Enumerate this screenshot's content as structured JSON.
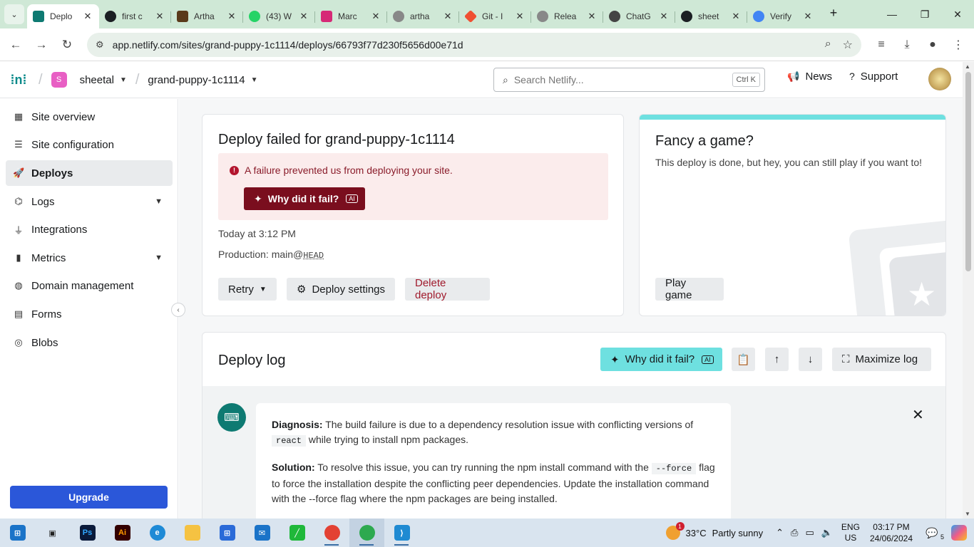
{
  "browser": {
    "tabs": [
      {
        "title": "Deplo",
        "favicon_color": "#0e7a72",
        "active": true
      },
      {
        "title": "first c",
        "favicon_color": "#1b1f23"
      },
      {
        "title": "Artha",
        "favicon_color": "#5a3a1a"
      },
      {
        "title": "(43) W",
        "favicon_color": "#25d366"
      },
      {
        "title": "Marc",
        "favicon_color": "#d62976"
      },
      {
        "title": "artha",
        "favicon_color": "#666666"
      },
      {
        "title": "Git - I",
        "favicon_color": "#f05032"
      },
      {
        "title": "Relea",
        "favicon_color": "#666666"
      },
      {
        "title": "ChatG",
        "favicon_color": "#444444"
      },
      {
        "title": "sheet",
        "favicon_color": "#1b1f23"
      },
      {
        "title": "Verify",
        "favicon_color": "#4285f4"
      }
    ],
    "url": "app.netlify.com/sites/grand-puppy-1c1114/deploys/66793f77d230f5656d00e71d"
  },
  "header": {
    "team_initial": "S",
    "team_name": "sheetal",
    "site_name": "grand-puppy-1c1114",
    "search_placeholder": "Search Netlify...",
    "search_shortcut": "Ctrl K",
    "news_label": "News",
    "support_label": "Support"
  },
  "sidebar": {
    "items": [
      {
        "label": "Site overview",
        "icon": "overview-icon"
      },
      {
        "label": "Site configuration",
        "icon": "config-icon"
      },
      {
        "label": "Deploys",
        "icon": "rocket-icon",
        "active": true
      },
      {
        "label": "Logs",
        "icon": "logs-icon",
        "expandable": true
      },
      {
        "label": "Integrations",
        "icon": "integrations-icon"
      },
      {
        "label": "Metrics",
        "icon": "metrics-icon",
        "expandable": true
      },
      {
        "label": "Domain management",
        "icon": "globe-icon"
      },
      {
        "label": "Forms",
        "icon": "forms-icon"
      },
      {
        "label": "Blobs",
        "icon": "blobs-icon"
      }
    ],
    "upgrade_label": "Upgrade"
  },
  "deploy_card": {
    "title": "Deploy failed for grand-puppy-1c1114",
    "error_message": "A failure prevented us from deploying your site.",
    "why_label": "Why did it fail?",
    "ai_badge": "AI",
    "time": "Today at 3:12 PM",
    "production_prefix": "Production: main@",
    "production_ref": "HEAD",
    "retry_label": "Retry",
    "settings_label": "Deploy settings",
    "delete_label": "Delete deploy"
  },
  "game_card": {
    "title": "Fancy a game?",
    "text": "This deploy is done, but hey, you can still play if you want to!",
    "play_label": "Play game"
  },
  "deploy_log": {
    "title": "Deploy log",
    "why_label": "Why did it fail?",
    "ai_badge": "AI",
    "maximize_label": "Maximize log",
    "diagnosis_label": "Diagnosis:",
    "diagnosis_text_1": "The build failure is due to a dependency resolution issue with conflicting versions of",
    "diagnosis_code": "react",
    "diagnosis_text_2": "while trying to install npm packages.",
    "solution_label": "Solution:",
    "solution_text_1": "To resolve this issue, you can try running the npm install command with the",
    "solution_code": "--force",
    "solution_text_2": "flag to force the installation despite the conflicting peer dependencies. Update the installation command with the --force flag where the npm packages are being installed."
  },
  "taskbar": {
    "weather_temp": "33°C",
    "weather_desc": "Partly sunny",
    "weather_badge": "1",
    "lang_1": "ENG",
    "lang_2": "US",
    "time": "03:17 PM",
    "date": "24/06/2024",
    "notif_count": "5"
  }
}
